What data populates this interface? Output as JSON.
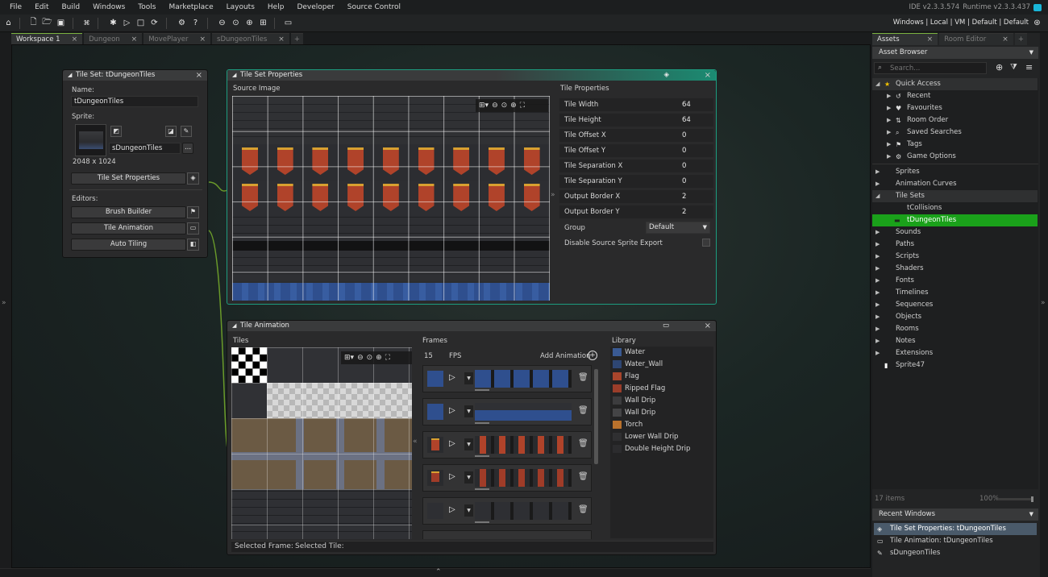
{
  "menu": [
    "File",
    "Edit",
    "Build",
    "Windows",
    "Tools",
    "Marketplace",
    "Layouts",
    "Help",
    "Developer",
    "Source Control"
  ],
  "version": {
    "ide": "IDE v2.3.3.574",
    "runtime": "Runtime v2.3.3.437"
  },
  "target": {
    "text": "Windows | Local | VM | Default | Default"
  },
  "doc_tabs": [
    {
      "label": "Workspace 1",
      "active": true
    },
    {
      "label": "Dungeon"
    },
    {
      "label": "MovePlayer"
    },
    {
      "label": "sDungeonTiles"
    }
  ],
  "tileset_panel": {
    "title": "Tile Set: tDungeonTiles",
    "name_label": "Name:",
    "name_value": "tDungeonTiles",
    "sprite_label": "Sprite:",
    "sprite_value": "sDungeonTiles",
    "sprite_more": "...",
    "size": "2048 x 1024",
    "properties_button": "Tile Set Properties",
    "editors_label": "Editors:",
    "editors": [
      "Brush Builder",
      "Tile Animation",
      "Auto Tiling"
    ]
  },
  "props_panel": {
    "title": "Tile Set Properties",
    "source_label": "Source Image",
    "tile_props_label": "Tile Properties",
    "props": [
      {
        "k": "Tile Width",
        "v": "64"
      },
      {
        "k": "Tile Height",
        "v": "64"
      },
      {
        "k": "Tile Offset X",
        "v": "0"
      },
      {
        "k": "Tile Offset Y",
        "v": "0"
      },
      {
        "k": "Tile Separation X",
        "v": "0"
      },
      {
        "k": "Tile Separation Y",
        "v": "0"
      },
      {
        "k": "Output Border X",
        "v": "2"
      },
      {
        "k": "Output Border Y",
        "v": "2"
      }
    ],
    "group_label": "Group",
    "group_value": "Default",
    "disable_label": "Disable Source Sprite Export"
  },
  "anim_panel": {
    "title": "Tile Animation",
    "tiles_label": "Tiles",
    "frames_label": "Frames",
    "fps_value": "15",
    "fps_label": "FPS",
    "add_animation": "Add Animation",
    "library_label": "Library",
    "library": [
      {
        "name": "Water",
        "color": "#3a5a93"
      },
      {
        "name": "Water_Wall",
        "color": "#2e4673"
      },
      {
        "name": "Flag",
        "color": "#a8452c"
      },
      {
        "name": "Ripped Flag",
        "color": "#9a3d2a"
      },
      {
        "name": "Wall Drip",
        "color": "#3c3c3e"
      },
      {
        "name": "Wall Drip",
        "color": "#444446"
      },
      {
        "name": "Torch",
        "color": "#b9712c"
      },
      {
        "name": "Lower Wall Drip",
        "color": "#2f2f31"
      },
      {
        "name": "Double Height Drip",
        "color": "#2c2c2e"
      }
    ],
    "selected_frame_label": "Selected Frame:",
    "selected_tile_label": "Selected Tile:"
  },
  "assets": {
    "tabs": [
      "Assets",
      "Room Editor"
    ],
    "browser_title": "Asset Browser",
    "search_placeholder": "Search...",
    "quick_access": "Quick Access",
    "quick_items": [
      "Recent",
      "Favourites",
      "Room Order",
      "Saved Searches",
      "Tags",
      "Game Options"
    ],
    "groups_a": [
      "Sprites",
      "Animation Curves"
    ],
    "tile_sets": "Tile Sets",
    "tile_set_items": [
      "tCollisions",
      "tDungeonTiles"
    ],
    "groups_b": [
      "Sounds",
      "Paths",
      "Scripts",
      "Shaders",
      "Fonts",
      "Timelines",
      "Sequences",
      "Objects",
      "Rooms",
      "Notes",
      "Extensions"
    ],
    "loose_item": "Sprite47",
    "count": "17 items",
    "zoom": "100%"
  },
  "recent": {
    "title": "Recent Windows",
    "items": [
      "Tile Set Properties: tDungeonTiles",
      "Tile Animation: tDungeonTiles",
      "sDungeonTiles"
    ]
  },
  "colors": {
    "accent_green": "#1aa11a",
    "panel_teal": "#1d9c7f",
    "tab_active": "#7ab23f"
  }
}
